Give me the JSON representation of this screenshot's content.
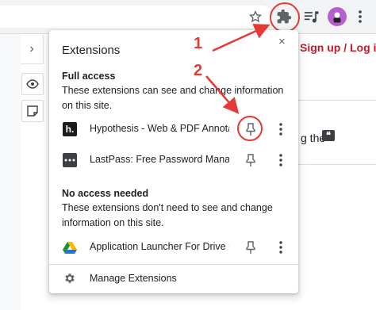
{
  "browser": {
    "toolbar_icons": [
      "star-icon",
      "puzzle-icon",
      "media-icon",
      "avatar",
      "kebab-icon"
    ],
    "accent_color": "#e53935"
  },
  "page": {
    "auth_text": "Sign up / Log in",
    "body_text_fragment": "g the"
  },
  "popup": {
    "title": "Extensions",
    "close_label": "×",
    "full_access": {
      "heading": "Full access",
      "description": "These extensions can see and change information on this site.",
      "items": [
        {
          "name": "Hypothesis - Web & PDF Annotation",
          "icon": "hypothesis-icon",
          "pinned": false
        },
        {
          "name": "LastPass: Free Password Manager",
          "icon": "lastpass-icon",
          "pinned": false
        }
      ]
    },
    "no_access": {
      "heading": "No access needed",
      "description": "These extensions don't need to see and change information on this site.",
      "items": [
        {
          "name": "Application Launcher For Drive (by Google)",
          "icon": "drive-icon",
          "pinned": false
        }
      ]
    },
    "manage_label": "Manage Extensions"
  },
  "annotations": {
    "step1": "1",
    "step2": "2"
  }
}
